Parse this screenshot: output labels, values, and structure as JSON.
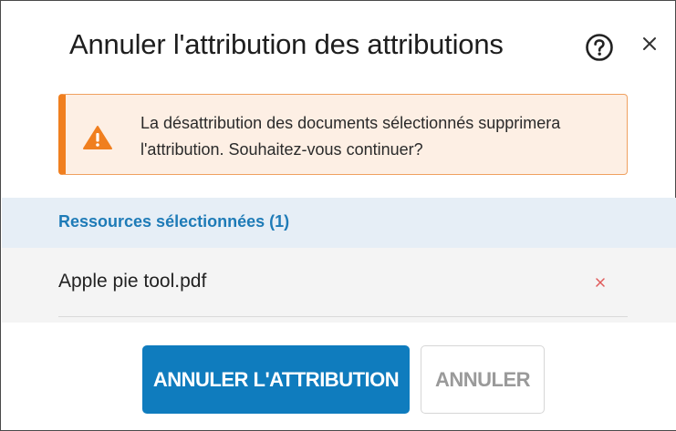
{
  "dialog": {
    "title": "Annuler l'attribution des attributions",
    "help_icon": "help-circle-icon",
    "close_icon": "close-icon"
  },
  "alert": {
    "icon": "warning-triangle-icon",
    "message": "La désattribution des documents sélectionnés supprimera l'attribution. Souhaitez-vous continuer?",
    "accent_color": "#f07f1f"
  },
  "resources": {
    "header": "Ressources sélectionnées (1)",
    "items": [
      {
        "name": "Apple pie tool.pdf",
        "remove_icon": "remove-x-icon"
      }
    ]
  },
  "actions": {
    "confirm_label": "ANNULER L'ATTRIBUTION",
    "cancel_label": "ANNULER",
    "primary_color": "#0f7cbe"
  }
}
